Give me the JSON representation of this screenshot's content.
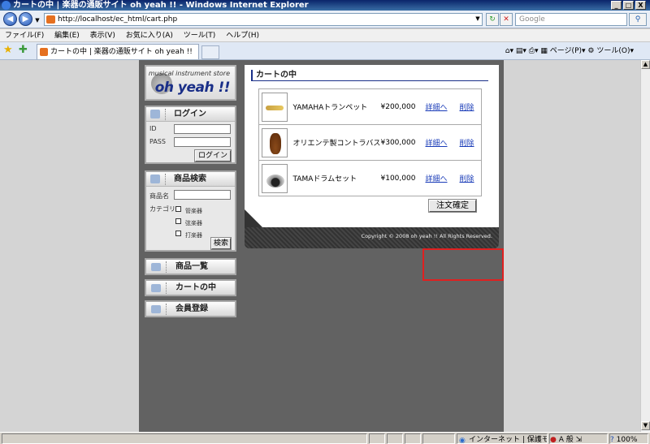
{
  "window": {
    "title": "カートの中 | 楽器の通販サイト oh yeah !! - Windows Internet Explorer",
    "min": "_",
    "max": "□",
    "close": "X"
  },
  "address": {
    "url": "http://localhost/ec_html/cart.php",
    "search_placeholder": "Google"
  },
  "menu": [
    "ファイル(F)",
    "編集(E)",
    "表示(V)",
    "お気に入り(A)",
    "ツール(T)",
    "ヘルプ(H)"
  ],
  "tab": {
    "label": "カートの中 | 楽器の通販サイト oh yeah !!"
  },
  "ie_toolbar": {
    "page": "ページ(P)",
    "tools": "ツール(O)"
  },
  "logo": {
    "tagline": "musical instrument store",
    "brand": "oh yeah !!"
  },
  "login": {
    "title": "ログイン",
    "id_label": "ID",
    "pass_label": "PASS",
    "button": "ログイン"
  },
  "search": {
    "title": "商品検索",
    "name_label": "商品名",
    "category_label": "カテゴリ",
    "categories": [
      "管楽器",
      "弦楽器",
      "打楽器"
    ],
    "button": "検索"
  },
  "nav": [
    "商品一覧",
    "カートの中",
    "会員登録"
  ],
  "cart": {
    "title": "カートの中",
    "detail_label": "詳細へ",
    "delete_label": "削除",
    "items": [
      {
        "name": "YAMAHAトランペット",
        "price": "¥200,000"
      },
      {
        "name": "オリエンテ製コントラバス",
        "price": "¥300,000"
      },
      {
        "name": "TAMAドラムセット",
        "price": "¥100,000"
      }
    ],
    "order_button": "注文確定",
    "copyright": "Copyright © 2008 oh yeah !! All Rights Reserved."
  },
  "status": {
    "zone": "インターネット | 保護モード: 有効",
    "zoom": "100%"
  },
  "colors": {
    "highlight": "#e02020",
    "link": "#1a3cb8",
    "brand": "#1a2f88"
  }
}
